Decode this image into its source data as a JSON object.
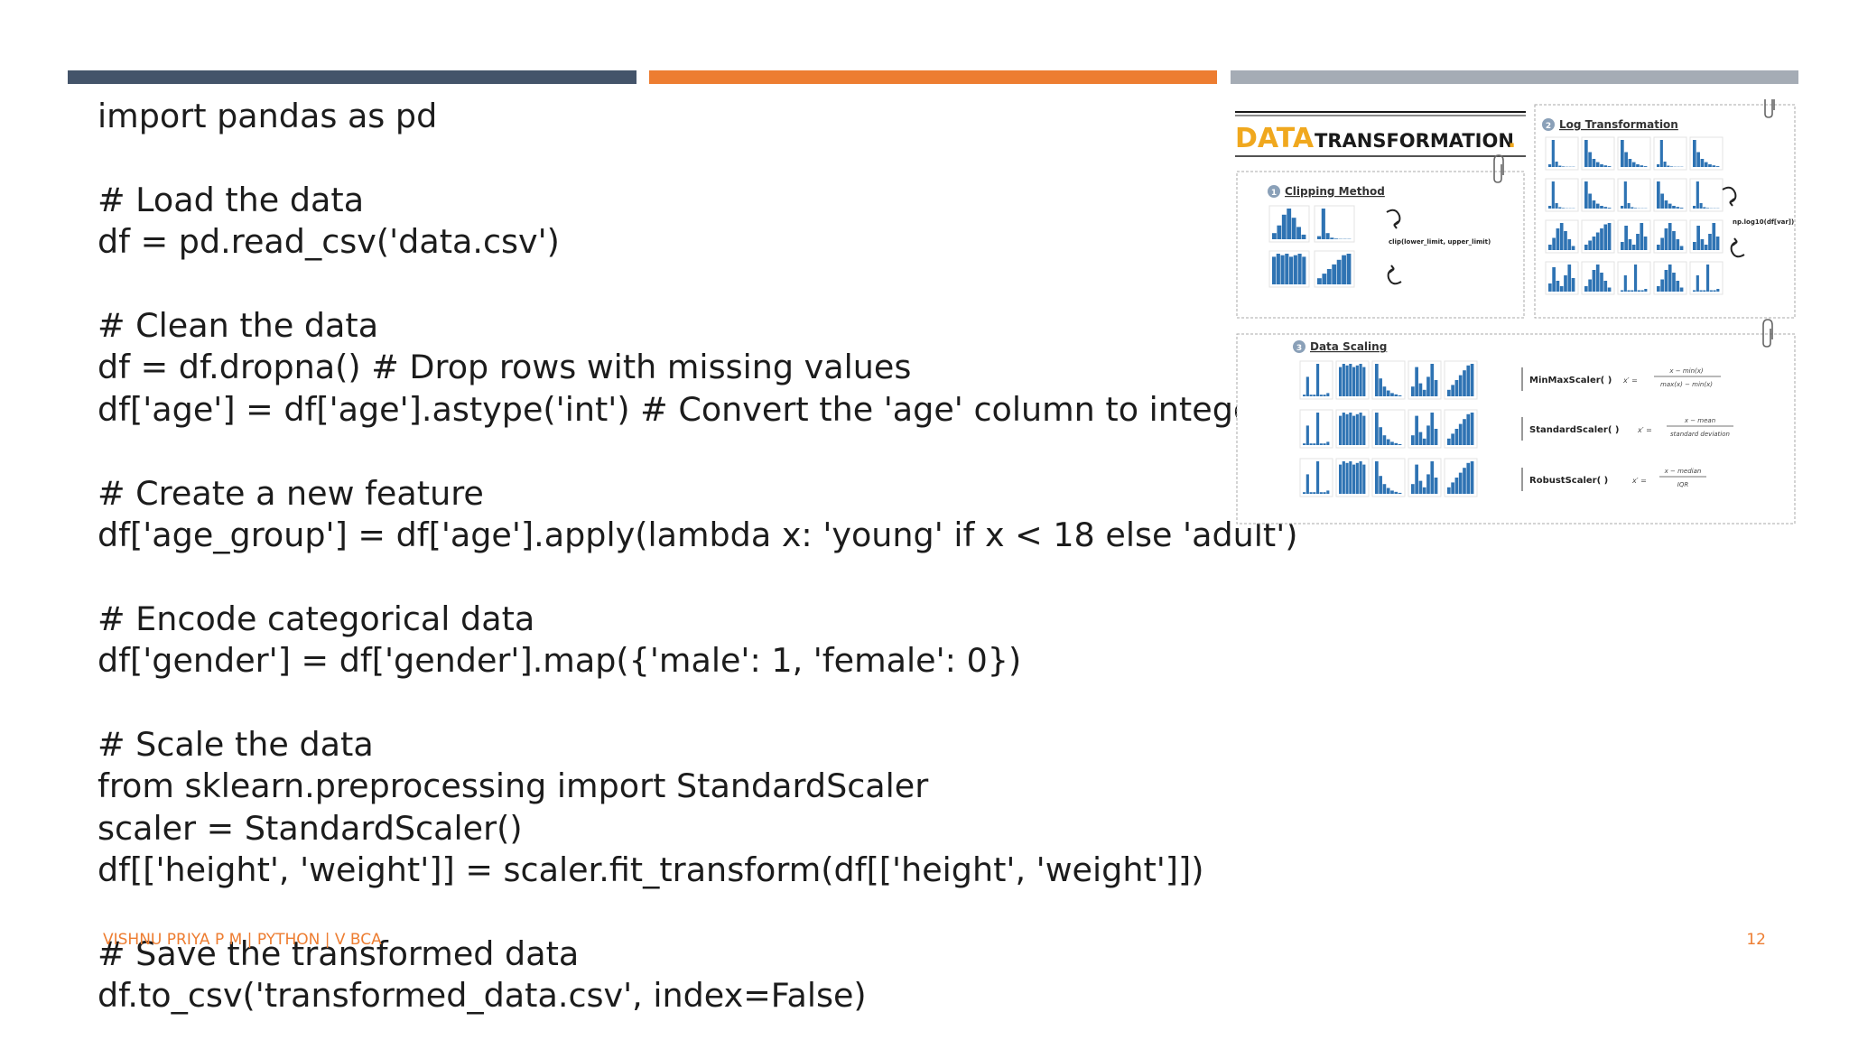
{
  "slide": {
    "code_lines": [
      "import pandas as pd",
      "",
      "# Load the data",
      "df = pd.read_csv('data.csv')",
      "",
      "# Clean the data",
      "df = df.dropna() # Drop rows with missing values",
      "df['age'] = df['age'].astype('int') # Convert the 'age' column to integers",
      "",
      "# Create a new feature",
      "df['age_group'] = df['age'].apply(lambda x: 'young' if x < 18 else 'adult')",
      "",
      "# Encode categorical data",
      "df['gender'] = df['gender'].map({'male': 1, 'female': 0})",
      "",
      "# Scale the data",
      "from sklearn.preprocessing import StandardScaler",
      "scaler = StandardScaler()",
      "df[['height', 'weight']] = scaler.fit_transform(df[['height', 'weight']])",
      "",
      "# Save the transformed data",
      "df.to_csv('transformed_data.csv', index=False)"
    ],
    "footer_left": "VISHNU PRIYA P M | PYTHON | V BCA",
    "page_number": "12"
  },
  "figure": {
    "title_word1": "DATA",
    "title_word2": "TRANSFORMATION",
    "title_dot": ".",
    "sections": [
      {
        "number": "1",
        "title": "Clipping Method",
        "formula": "clip(lower_limit, upper_limit)"
      },
      {
        "number": "2",
        "title": "Log Transformation",
        "formula": "np.log10(df[var])"
      },
      {
        "number": "3",
        "title": "Data Scaling"
      }
    ],
    "scalers": [
      {
        "name": "MinMaxScaler( )",
        "numerator": "x − min(x)",
        "denominator": "max(x) − min(x)"
      },
      {
        "name": "StandardScaler( )",
        "numerator": "x − mean",
        "denominator": "standard deviation"
      },
      {
        "name": "RobustScaler( )",
        "numerator": "x − median",
        "denominator": "IQR"
      }
    ],
    "prime_x": "x′ =",
    "colors": {
      "accent": "#f0a81e",
      "blue": "#2e73b3",
      "dark": "#1a1a1a"
    }
  },
  "theme": {
    "bar1": "#44546a",
    "bar2": "#ed7d31",
    "bar3": "#a5acb5"
  }
}
